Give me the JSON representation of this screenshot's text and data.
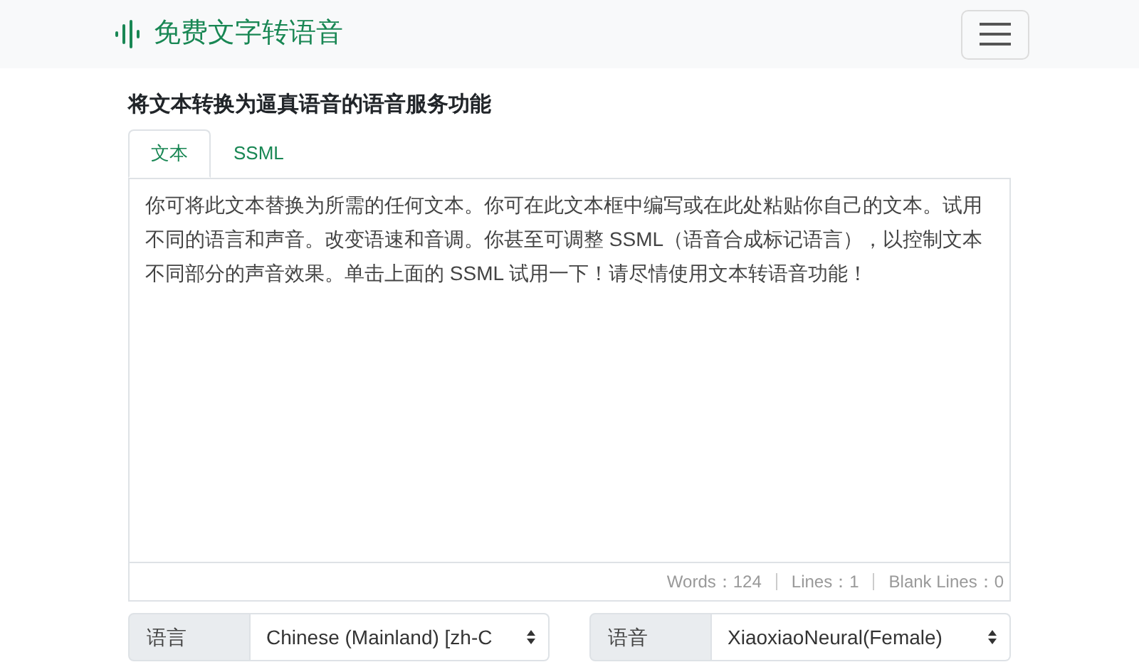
{
  "navbar": {
    "brand": "免费文字转语音"
  },
  "heading": "将文本转换为逼真语音的语音服务功能",
  "tabs": [
    {
      "label": "文本",
      "selected": true
    },
    {
      "label": "SSML",
      "selected": false
    }
  ],
  "editor": {
    "value": "你可将此文本替换为所需的任何文本。你可在此文本框中编写或在此处粘贴你自己的文本。试用不同的语言和声音。改变语速和音调。你甚至可调整 SSML（语音合成标记语言），以控制文本不同部分的声音效果。单击上面的 SSML 试用一下！请尽情使用文本转语音功能！"
  },
  "stats": [
    "Words：124",
    "Lines：1",
    "Blank Lines：0"
  ],
  "selects": [
    {
      "label": "语言",
      "value": "Chinese (Mainland) [zh-C"
    },
    {
      "label": "语音",
      "value": "XiaoxiaoNeural(Female)"
    }
  ]
}
